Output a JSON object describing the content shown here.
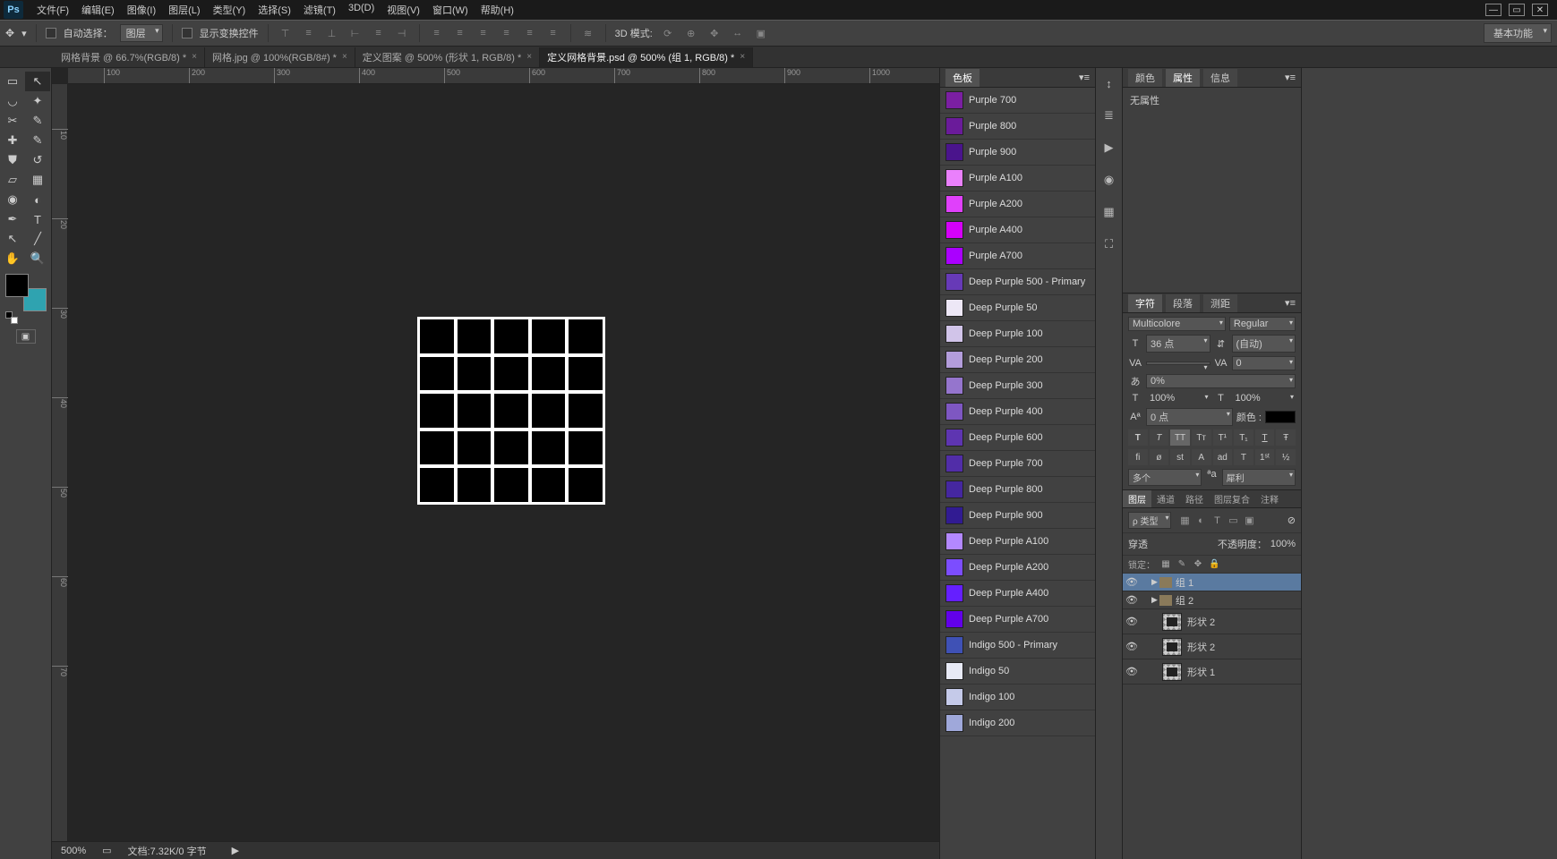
{
  "menu": [
    "文件(F)",
    "编辑(E)",
    "图像(I)",
    "图层(L)",
    "类型(Y)",
    "选择(S)",
    "滤镜(T)",
    "3D(D)",
    "视图(V)",
    "窗口(W)",
    "帮助(H)"
  ],
  "options": {
    "auto_select_label": "自动选择：",
    "auto_select_value": "图层",
    "transform_label": "显示变换控件",
    "mode_3d": "3D 模式:",
    "workspace": "基本功能"
  },
  "tabs": [
    {
      "label": "网格背景 @ 66.7%(RGB/8) *",
      "active": false
    },
    {
      "label": "网格.jpg @ 100%(RGB/8#) *",
      "active": false
    },
    {
      "label": "定义图案 @ 500% (形状 1, RGB/8) *",
      "active": false
    },
    {
      "label": "定义网格背景.psd @ 500% (组 1, RGB/8) *",
      "active": true
    }
  ],
  "ruler_h": [
    "100",
    "200",
    "300",
    "400",
    "500",
    "600",
    "700",
    "800",
    "900",
    "1000"
  ],
  "ruler_v": [
    "10",
    "20",
    "30",
    "40",
    "50",
    "60",
    "70"
  ],
  "status": {
    "zoom": "500%",
    "doc": "文档:7.32K/0 字节"
  },
  "swatches": {
    "tab": "色板",
    "items": [
      {
        "name": "Purple 700",
        "c": "#7b1fa2"
      },
      {
        "name": "Purple 800",
        "c": "#6a1b9a"
      },
      {
        "name": "Purple 900",
        "c": "#4a148c"
      },
      {
        "name": "Purple A100",
        "c": "#ea80fc"
      },
      {
        "name": "Purple A200",
        "c": "#e040fb"
      },
      {
        "name": "Purple A400",
        "c": "#d500f9"
      },
      {
        "name": "Purple A700",
        "c": "#aa00ff"
      },
      {
        "name": "Deep Purple 500 - Primary",
        "c": "#673ab7"
      },
      {
        "name": "Deep Purple 50",
        "c": "#ede7f6"
      },
      {
        "name": "Deep Purple 100",
        "c": "#d1c4e9"
      },
      {
        "name": "Deep Purple 200",
        "c": "#b39ddb"
      },
      {
        "name": "Deep Purple 300",
        "c": "#9575cd"
      },
      {
        "name": "Deep Purple 400",
        "c": "#7e57c2"
      },
      {
        "name": "Deep Purple 600",
        "c": "#5e35b1"
      },
      {
        "name": "Deep Purple 700",
        "c": "#512da8"
      },
      {
        "name": "Deep Purple 800",
        "c": "#4527a0"
      },
      {
        "name": "Deep Purple 900",
        "c": "#311b92"
      },
      {
        "name": "Deep Purple A100",
        "c": "#b388ff"
      },
      {
        "name": "Deep Purple A200",
        "c": "#7c4dff"
      },
      {
        "name": "Deep Purple A400",
        "c": "#651fff"
      },
      {
        "name": "Deep Purple A700",
        "c": "#6200ea"
      },
      {
        "name": "Indigo 500 - Primary",
        "c": "#3f51b5"
      },
      {
        "name": "Indigo 50",
        "c": "#e8eaf6"
      },
      {
        "name": "Indigo 100",
        "c": "#c5cae9"
      },
      {
        "name": "Indigo 200",
        "c": "#9fa8da"
      }
    ]
  },
  "properties": {
    "tabs": [
      "颜色",
      "属性",
      "信息"
    ],
    "active": 1,
    "body": "无属性"
  },
  "character": {
    "tabs": [
      "字符",
      "段落",
      "测距"
    ],
    "font": "Multicolore",
    "style": "Regular",
    "size": "36 点",
    "leading": "(自动)",
    "tracking": "",
    "kerning": "0",
    "pct": "0%",
    "hscale": "100%",
    "vscale": "100%",
    "baseline": "0 点",
    "color_label": "颜色 :",
    "lang": "多个",
    "aa": "犀利"
  },
  "layers": {
    "tabs": [
      "图层",
      "通道",
      "路径",
      "图层复合",
      "注释"
    ],
    "kind": "ρ 类型",
    "blend": "穿透",
    "opacity_label": "不透明度：",
    "opacity_val": "100%",
    "lock_label": "锁定：",
    "items": [
      {
        "type": "group",
        "name": "组 1",
        "sel": true
      },
      {
        "type": "group",
        "name": "组 2",
        "sel": false
      },
      {
        "type": "shape",
        "name": "形状 2",
        "sel": false
      },
      {
        "type": "shape",
        "name": "形状 2",
        "sel": false
      },
      {
        "type": "shape",
        "name": "形状 1",
        "sel": false
      }
    ]
  }
}
